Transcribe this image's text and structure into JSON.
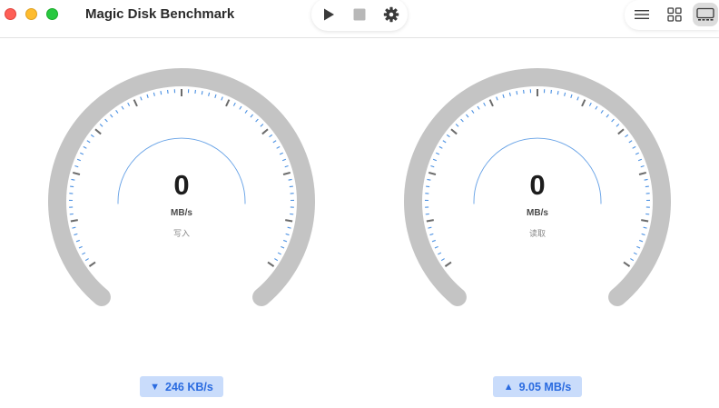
{
  "window": {
    "title": "Magic Disk Benchmark"
  },
  "toolbar": {
    "play_icon": "play-icon",
    "stop_icon": "stop-icon",
    "settings_icon": "gear-icon"
  },
  "view_switcher": {
    "options": [
      "list-view-icon",
      "grid-view-icon",
      "gauge-view-icon"
    ],
    "selected": "gauge-view-icon"
  },
  "gauges": [
    {
      "value": "0",
      "unit": "MB/s",
      "label": "写入",
      "speed_indicator": "▼",
      "speed": "246 KB/s"
    },
    {
      "value": "0",
      "unit": "MB/s",
      "label": "读取",
      "speed_indicator": "▲",
      "speed": "9.05 MB/s"
    }
  ],
  "colors": {
    "arc": "#c4c4c4",
    "tick": "#4a90e2",
    "major_tick": "#6b6b6b",
    "badge_bg": "#c9dcfb",
    "badge_text": "#2a6be0"
  }
}
